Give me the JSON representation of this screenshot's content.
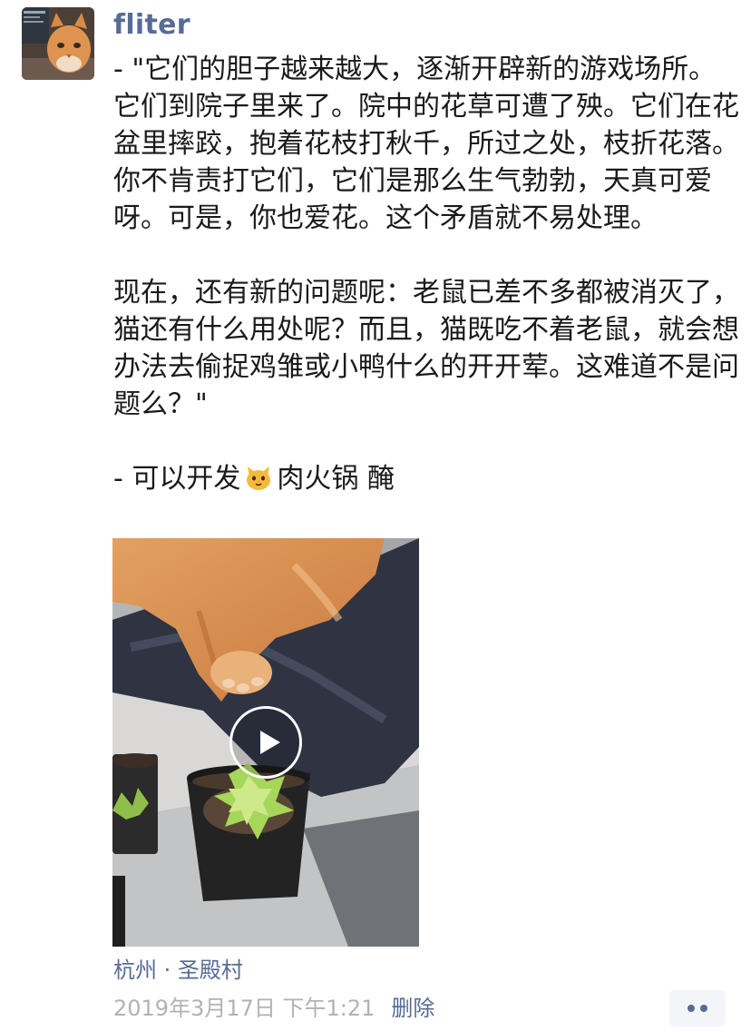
{
  "post": {
    "author": "fliter",
    "paragraph_1": "- \"它们的胆子越来越大，逐渐开辟新的游戏场所。它们到院子里来了。院中的花草可遭了殃。它们在花盆里摔跤，抱着花枝打秋千，所过之处，枝折花落。你不肯责打它们，它们是那么生气勃勃，天真可爱呀。可是，你也爱花。这个矛盾就不易处理。",
    "paragraph_2": "现在，还有新的问题呢：老鼠已差不多都被消灭了，猫还有什么用处呢？而且，猫既吃不着老鼠，就会想办法去偷捉鸡雏或小鸭什么的开开荤。这难道不是问题么？\"",
    "paragraph_3_before": "- 可以开发",
    "paragraph_3_after": "肉火锅 醃",
    "emoji": "cat-face-emoji",
    "location": "杭州 · 圣殿村",
    "timestamp": "2019年3月17日 下午1:21",
    "delete_label": "删除"
  },
  "colors": {
    "link_blue": "#576b95",
    "meta_gray": "#b2b2b2",
    "text": "#1a1a1a",
    "more_button_bg": "#f4f5f8"
  },
  "icons": {
    "play": "play-icon",
    "more": "more-dots-icon"
  }
}
